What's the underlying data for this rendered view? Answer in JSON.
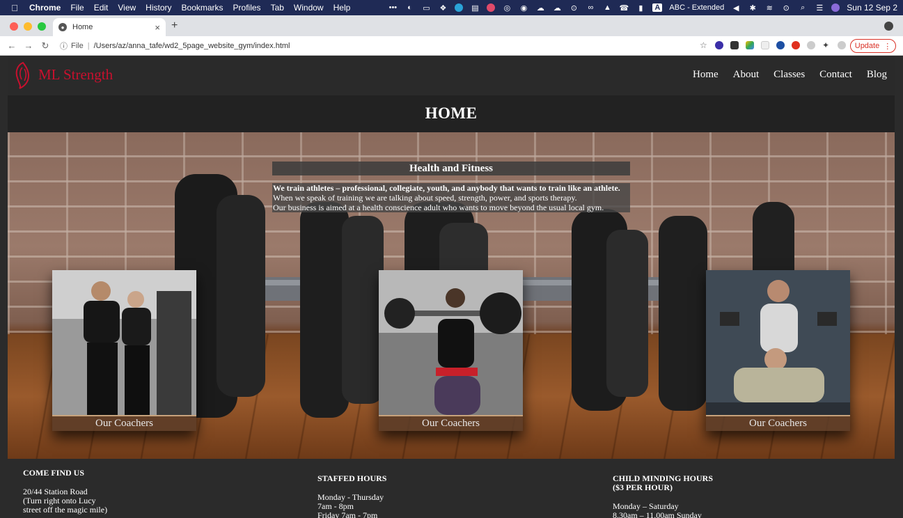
{
  "menubar": {
    "app": "Chrome",
    "items": [
      "File",
      "Edit",
      "View",
      "History",
      "Bookmarks",
      "Profiles",
      "Tab",
      "Window",
      "Help"
    ],
    "input_source": "ABC - Extended",
    "clock": "Sun 12 Sep 2"
  },
  "browser": {
    "tab_title": "Home",
    "address_prefix": "File",
    "url": "/Users/az/anna_tafe/wd2_5page_website_gym/index.html",
    "update_label": "Update"
  },
  "site": {
    "brand": "ML Strength",
    "nav": [
      "Home",
      "About",
      "Classes",
      "Contact",
      "Blog"
    ],
    "page_title": "HOME",
    "intro": {
      "heading": "Health and Fitness",
      "lead": "We train athletes – professional, collegiate, youth, and anybody that wants to train like an athlete.",
      "line2": "When we speak of training we are talking about speed, strength, power, and sports therapy.",
      "line3": "Our business is aimed at a health conscience adult who wants to move beyond the usual local gym."
    },
    "cards": [
      {
        "caption": "Our Coachers"
      },
      {
        "caption": "Our Coachers"
      },
      {
        "caption": "Our Coachers"
      }
    ],
    "footer": {
      "find_us": {
        "heading": "COME FIND US",
        "lines": [
          "20/44 Station Road",
          "(Turn right onto Lucy",
          "street off the magic mile)"
        ]
      },
      "staffed": {
        "heading": "STAFFED HOURS",
        "lines": [
          "Monday - Thursday",
          "7am - 8pm",
          "Friday 7am - 7pm"
        ]
      },
      "child": {
        "heading_line1": "CHILD MINDING HOURS",
        "heading_line2": "($3 PER HOUR)",
        "lines": [
          "Monday – Saturday",
          "8.30am – 11.00am Sunday"
        ]
      }
    }
  },
  "colors": {
    "brand_red": "#c8102e",
    "menubar": "#1f2a55",
    "page_bg": "#2b2b2b",
    "update_red": "#d93025"
  }
}
